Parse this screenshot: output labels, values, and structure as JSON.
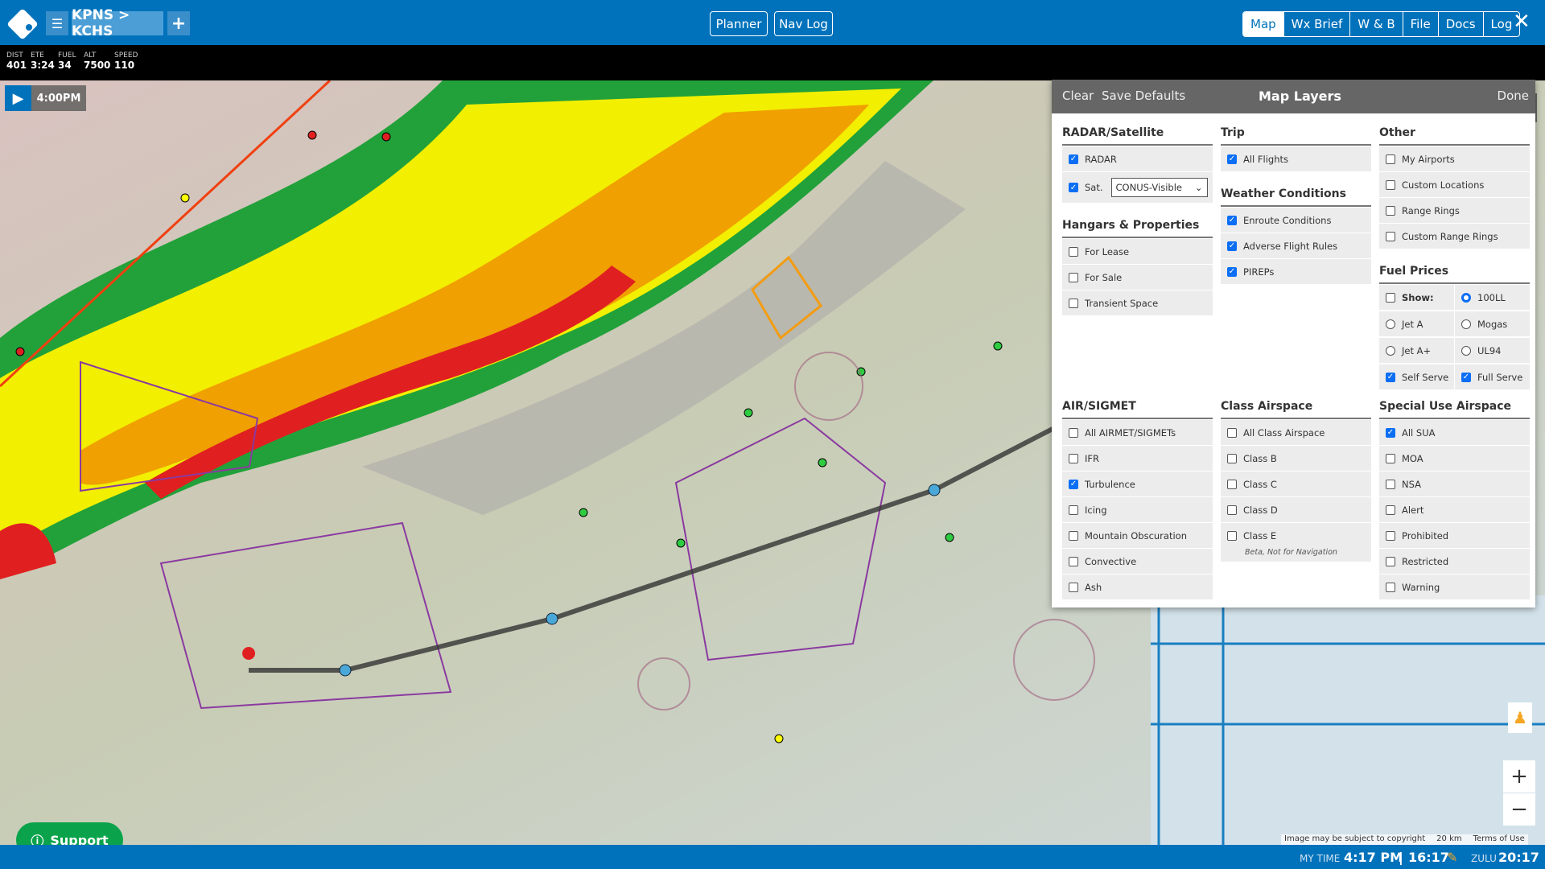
{
  "header": {
    "route": "KPNS > KCHS",
    "planner_label": "Planner",
    "navlog_label": "Nav Log",
    "tabs": [
      "Map",
      "Wx Brief",
      "W & B",
      "File",
      "Docs",
      "Log"
    ],
    "active_tab": "Map",
    "close_icon": "close-icon",
    "brand_color": "#0072bb"
  },
  "stats": [
    {
      "label": "DIST",
      "value": "401"
    },
    {
      "label": "ETE",
      "value": "3:24"
    },
    {
      "label": "FUEL",
      "value": "34"
    },
    {
      "label": "ALT",
      "value": "7500"
    },
    {
      "label": "SPEED",
      "value": "110"
    }
  ],
  "playback": {
    "time": "4:00PM"
  },
  "map_labels": {
    "support": "Support",
    "copyright": "Image may be subject to copyright",
    "scale": "20 km",
    "terms": "Terms of Use"
  },
  "layers_panel": {
    "clear": "Clear",
    "save_defaults": "Save Defaults",
    "title": "Map Layers",
    "done": "Done",
    "radar_sat": {
      "title": "RADAR/Satellite",
      "radar": {
        "label": "RADAR",
        "checked": true
      },
      "sat": {
        "label": "Sat.",
        "checked": true,
        "selected": "CONUS-Visible"
      }
    },
    "hangars": {
      "title": "Hangars & Properties",
      "items": [
        {
          "label": "For Lease",
          "checked": false
        },
        {
          "label": "For Sale",
          "checked": false
        },
        {
          "label": "Transient Space",
          "checked": false
        }
      ]
    },
    "trip": {
      "title": "Trip",
      "items": [
        {
          "label": "All Flights",
          "checked": true
        }
      ]
    },
    "weather": {
      "title": "Weather Conditions",
      "items": [
        {
          "label": "Enroute Conditions",
          "checked": true
        },
        {
          "label": "Adverse Flight Rules",
          "checked": true
        },
        {
          "label": "PIREPs",
          "checked": true
        }
      ]
    },
    "other": {
      "title": "Other",
      "items": [
        {
          "label": "My Airports",
          "checked": false
        },
        {
          "label": "Custom Locations",
          "checked": false
        },
        {
          "label": "Range Rings",
          "checked": false
        },
        {
          "label": "Custom Range Rings",
          "checked": false
        }
      ]
    },
    "fuel": {
      "title": "Fuel Prices",
      "show": {
        "label": "Show:",
        "checked": false
      },
      "types": [
        {
          "label": "100LL",
          "selected": true
        },
        {
          "label": "Jet A",
          "selected": false
        },
        {
          "label": "Mogas",
          "selected": false
        },
        {
          "label": "Jet A+",
          "selected": false
        },
        {
          "label": "UL94",
          "selected": false
        }
      ],
      "self_serve": {
        "label": "Self Serve",
        "checked": true
      },
      "full_serve": {
        "label": "Full Serve",
        "checked": true
      }
    },
    "airsigmet": {
      "title": "AIR/SIGMET",
      "items": [
        {
          "label": "All AIRMET/SIGMETs",
          "checked": false
        },
        {
          "label": "IFR",
          "checked": false
        },
        {
          "label": "Turbulence",
          "checked": true
        },
        {
          "label": "Icing",
          "checked": false
        },
        {
          "label": "Mountain Obscuration",
          "checked": false
        },
        {
          "label": "Convective",
          "checked": false
        },
        {
          "label": "Ash",
          "checked": false
        }
      ]
    },
    "class_airspace": {
      "title": "Class Airspace",
      "items": [
        {
          "label": "All Class Airspace",
          "checked": false
        },
        {
          "label": "Class B",
          "checked": false
        },
        {
          "label": "Class C",
          "checked": false
        },
        {
          "label": "Class D",
          "checked": false
        },
        {
          "label": "Class E",
          "checked": false
        }
      ],
      "note": "Beta, Not for Navigation"
    },
    "sua": {
      "title": "Special Use Airspace",
      "items": [
        {
          "label": "All SUA",
          "checked": true
        },
        {
          "label": "MOA",
          "checked": false
        },
        {
          "label": "NSA",
          "checked": false
        },
        {
          "label": "Alert",
          "checked": false
        },
        {
          "label": "Prohibited",
          "checked": false
        },
        {
          "label": "Restricted",
          "checked": false
        },
        {
          "label": "Warning",
          "checked": false
        }
      ]
    }
  },
  "footer": {
    "my_time_label": "MY TIME",
    "my_time": "4:17 PM",
    "local_24": "16:17",
    "zulu_label": "ZULU",
    "zulu": "20:17"
  }
}
